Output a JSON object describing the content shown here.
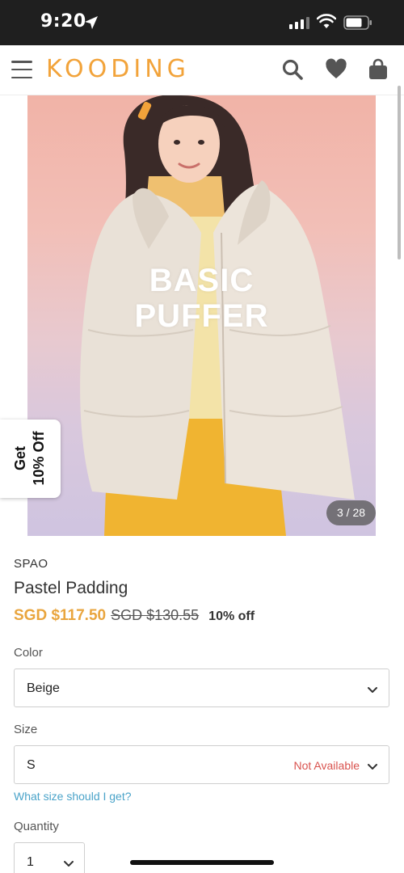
{
  "status_bar": {
    "time": "9:20"
  },
  "header": {
    "brand": "KOODING"
  },
  "product": {
    "hero_line1": "BASIC",
    "hero_line2": "PUFFER",
    "image_counter": "3 / 28",
    "brand": "SPAO",
    "title": "Pastel Padding",
    "sale_price": "SGD $117.50",
    "original_price": "SGD $130.55",
    "discount": "10% off"
  },
  "promo_tab": {
    "line1": "Get",
    "line2": "10% Off"
  },
  "options": {
    "color_label": "Color",
    "color_value": "Beige",
    "size_label": "Size",
    "size_value": "S",
    "size_status": "Not Available",
    "size_help_link": "What size should I get?",
    "quantity_label": "Quantity",
    "quantity_value": "1"
  },
  "colors": {
    "brand_accent": "#f2a33a",
    "sale_price": "#e9a53e",
    "unavailable": "#d9534f",
    "link": "#4aa3c9"
  }
}
